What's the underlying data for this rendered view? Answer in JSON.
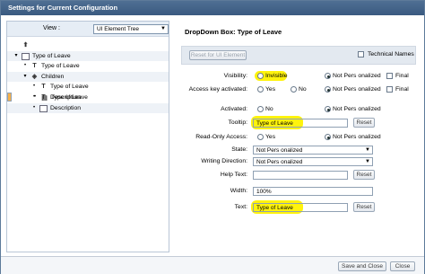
{
  "window": {
    "title": "Settings for Current Configuration"
  },
  "left": {
    "view_label": "View :",
    "view_value": "UI Element Tree",
    "tree": [
      {
        "label": "",
        "icon": "up-icon",
        "indent": 0,
        "twisty": "",
        "alt": false,
        "selected": false
      },
      {
        "label": "Type of Leave",
        "icon": "container-icon",
        "indent": 0,
        "twisty": "▾",
        "alt": true,
        "selected": false
      },
      {
        "label": "Type of Leave",
        "icon": "text-icon",
        "indent": 1,
        "twisty": "•",
        "alt": false,
        "selected": false
      },
      {
        "label": "Children",
        "icon": "children-icon",
        "indent": 1,
        "twisty": "▾",
        "alt": true,
        "selected": false
      },
      {
        "label": "Type of Leave",
        "icon": "text-icon",
        "indent": 2,
        "twisty": "•",
        "alt": false,
        "selected": false
      },
      {
        "label": "Type of Leave",
        "icon": "dropdown-icon",
        "indent": 2,
        "twisty": "•",
        "alt": false,
        "selected": true
      },
      {
        "label": "Description",
        "icon": "text-icon",
        "indent": 2,
        "twisty": "•",
        "alt": false,
        "selected": false
      },
      {
        "label": "Description",
        "icon": "box-icon",
        "indent": 2,
        "twisty": "•",
        "alt": true,
        "selected": false
      }
    ]
  },
  "right": {
    "header": "DropDown Box: Type of Leave",
    "reset_ui_button": "Reset for UI Element",
    "technical_names": "Technical Names",
    "visibility": {
      "label": "Visibility:",
      "opt1": "Invisible",
      "opt2": "Not Pers onalized",
      "final": "Final"
    },
    "access_key": {
      "label": "Access key activated:",
      "opt_yes": "Yes",
      "opt_no": "No",
      "opt_np": "Not Pers onalized",
      "final": "Final"
    },
    "activated": {
      "label": "Activated:",
      "opt_no": "No",
      "opt_np": "Not Pers onalized"
    },
    "tooltip": {
      "label": "Tooltip:",
      "value": "Type of Leave",
      "reset": "Reset"
    },
    "read_only": {
      "label": "Read-Only Access:",
      "opt_yes": "Yes",
      "opt_np": "Not Pers onalized"
    },
    "state": {
      "label": "State:",
      "value": "Not Pers onalized"
    },
    "writing_direction": {
      "label": "Writing Direction:",
      "value": "Not Pers onalized"
    },
    "help_text": {
      "label": "Help Text:",
      "value": "",
      "reset": "Reset"
    },
    "width": {
      "label": "Width:",
      "value": "100%"
    },
    "text": {
      "label": "Text:",
      "value": "Type of Leave",
      "reset": "Reset"
    }
  },
  "footer": {
    "save_close": "Save and Close",
    "close": "Close"
  },
  "colors": {
    "highlight": "#fff200",
    "selected_row": "#f7b14a",
    "titlebar": "#3f628a"
  }
}
